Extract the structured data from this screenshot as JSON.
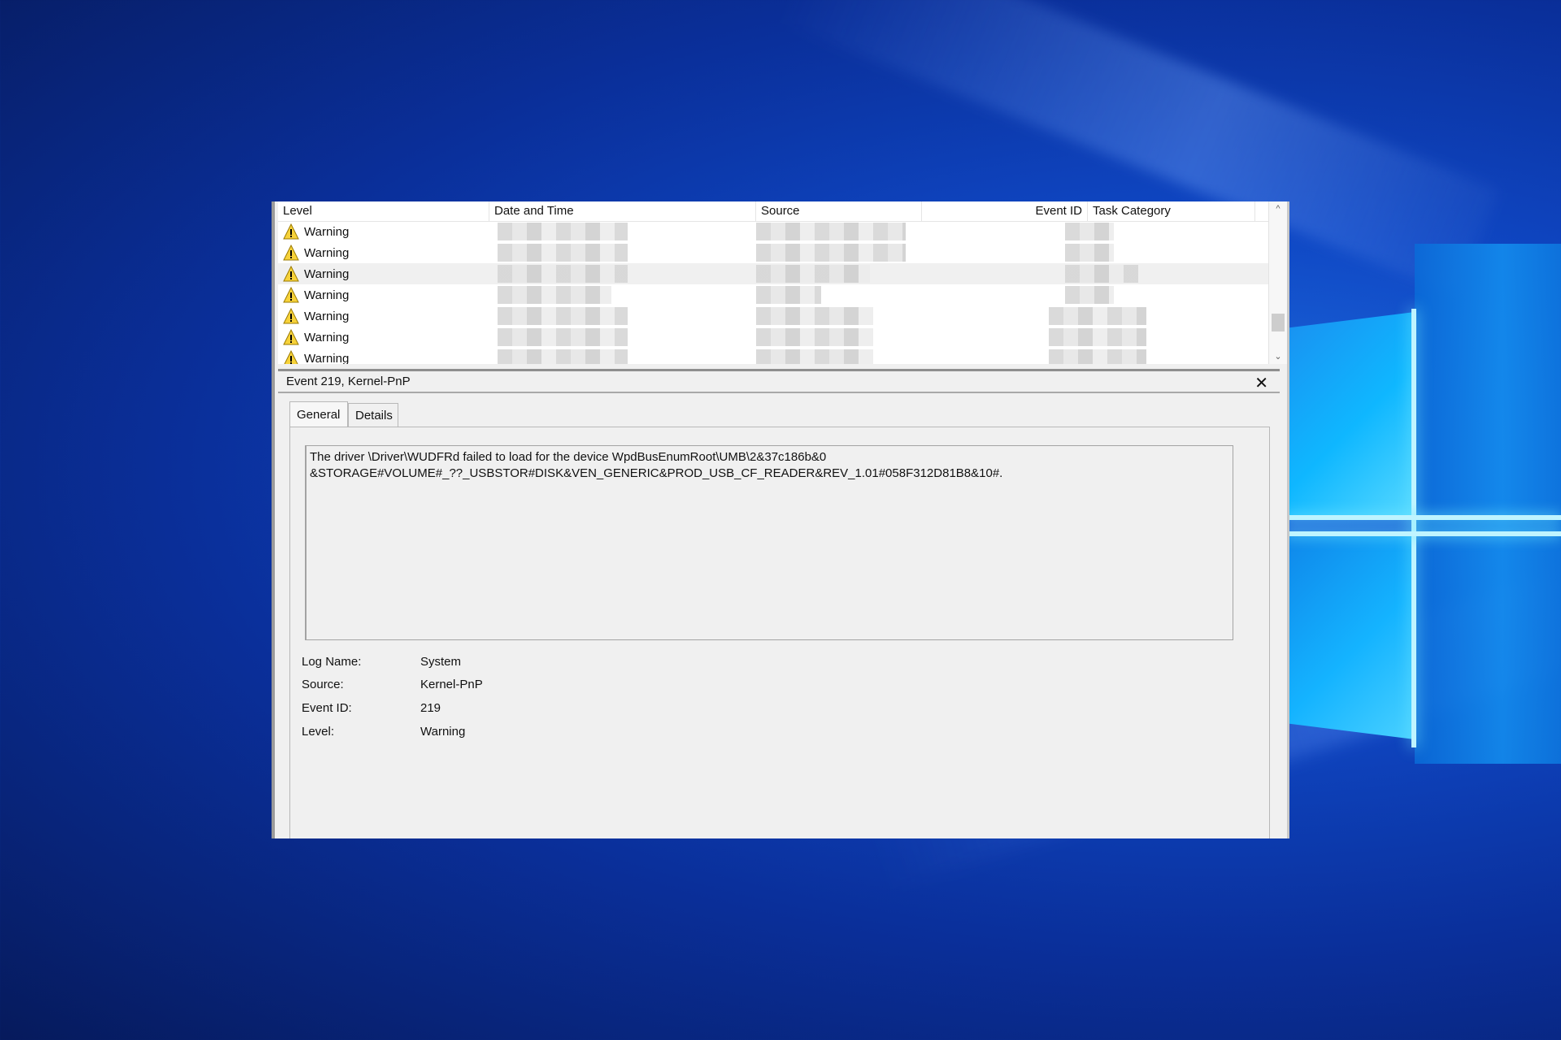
{
  "list": {
    "columns": [
      "Level",
      "Date and Time",
      "Source",
      "Event ID",
      "Task Category"
    ],
    "rows": [
      {
        "level": "Warning"
      },
      {
        "level": "Warning"
      },
      {
        "level": "Warning"
      },
      {
        "level": "Warning"
      },
      {
        "level": "Warning"
      },
      {
        "level": "Warning"
      },
      {
        "level": "Warning"
      }
    ],
    "scroll_up": "^",
    "scroll_down": "⌄"
  },
  "detail": {
    "title": "Event 219, Kernel-PnP",
    "close": "✕",
    "tabs": [
      "General",
      "Details"
    ],
    "description": "The driver \\Driver\\WUDFRd failed to load for the device WpdBusEnumRoot\\UMB\\2&37c186b&0\n&STORAGE#VOLUME#_??_USBSTOR#DISK&VEN_GENERIC&PROD_USB_CF_READER&REV_1.01#058F312D81B8&10#.",
    "properties": [
      {
        "label": "Log Name:",
        "value": "System"
      },
      {
        "label": "Source:",
        "value": "Kernel-PnP"
      },
      {
        "label": "Event ID:",
        "value": "219"
      },
      {
        "label": "Level:",
        "value": "Warning"
      }
    ]
  },
  "colors": {
    "warning_fill": "#f7d23a",
    "selected_row": "#f0f0f0",
    "desktop_blue": "#0f47c4"
  }
}
